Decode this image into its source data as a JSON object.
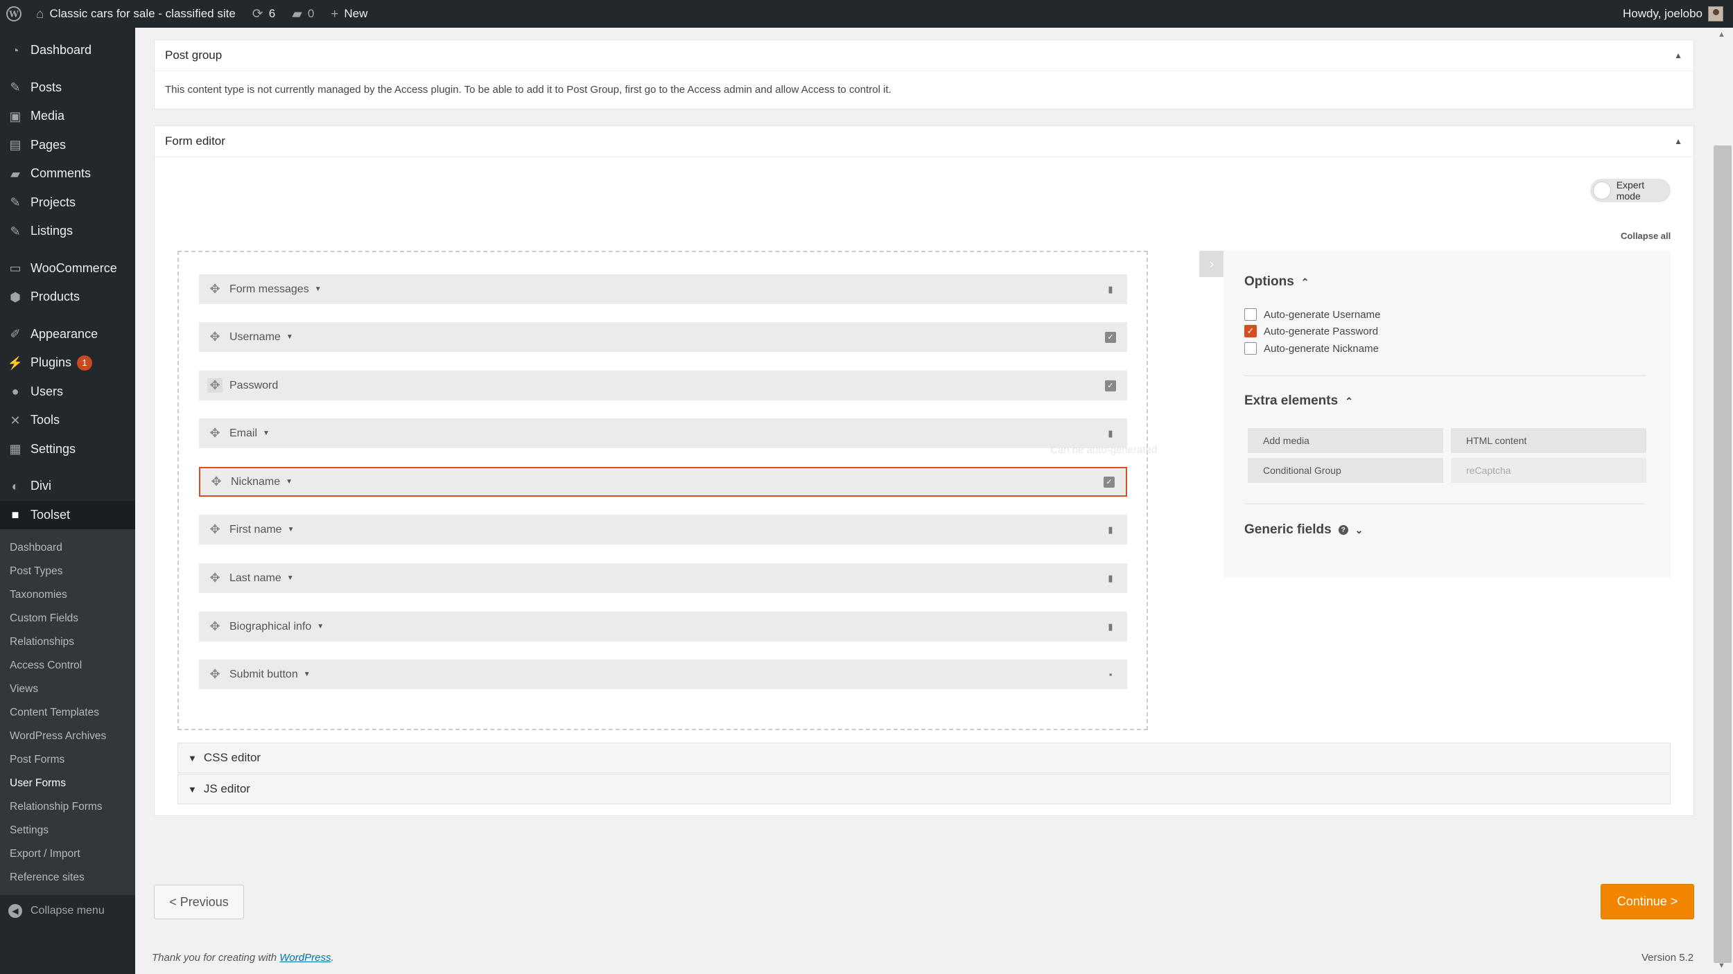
{
  "adminbar": {
    "site_title": "Classic cars for sale - classified site",
    "updates_count": "6",
    "comments_count": "0",
    "new_label": "New",
    "howdy": "Howdy, joelobo"
  },
  "menu": {
    "dashboard": "Dashboard",
    "posts": "Posts",
    "media": "Media",
    "pages": "Pages",
    "comments": "Comments",
    "projects": "Projects",
    "listings": "Listings",
    "woocommerce": "WooCommerce",
    "products": "Products",
    "appearance": "Appearance",
    "plugins": "Plugins",
    "plugins_count": "1",
    "users": "Users",
    "tools": "Tools",
    "settings": "Settings",
    "divi": "Divi",
    "toolset": "Toolset",
    "submenu": [
      "Dashboard",
      "Post Types",
      "Taxonomies",
      "Custom Fields",
      "Relationships",
      "Access Control",
      "Views",
      "Content Templates",
      "WordPress Archives",
      "Post Forms",
      "User Forms",
      "Relationship Forms",
      "Settings",
      "Export / Import",
      "Reference sites"
    ],
    "collapse": "Collapse menu"
  },
  "post_group": {
    "title": "Post group",
    "message": "This content type is not currently managed by the Access plugin. To be able to add it to Post Group, first go to the Access admin and allow Access to control it."
  },
  "form_editor": {
    "title": "Form editor",
    "expert_mode": "Expert mode",
    "collapse_all": "Collapse all",
    "ghost_text": "Can be auto-generated",
    "fields": [
      "Form messages",
      "Username",
      "Password",
      "Email",
      "Nickname",
      "First name",
      "Last name",
      "Biographical info",
      "Submit button"
    ],
    "options_title": "Options",
    "options": [
      {
        "label": "Auto-generate Username",
        "checked": false
      },
      {
        "label": "Auto-generate Password",
        "checked": true
      },
      {
        "label": "Auto-generate Nickname",
        "checked": false
      }
    ],
    "extra_title": "Extra elements",
    "extra": [
      "Add media",
      "HTML content",
      "Conditional Group",
      "reCaptcha"
    ],
    "generic_title": "Generic fields",
    "css_editor": "CSS editor",
    "js_editor": "JS editor"
  },
  "nav": {
    "previous": "< Previous",
    "continue": "Continue >"
  },
  "footer": {
    "thanks": "Thank you for creating with ",
    "wordpress": "WordPress",
    "period": ".",
    "version": "Version 5.2"
  },
  "colors": {
    "accent": "#d54e21",
    "continue": "#f18500",
    "adminbar": "#23282d"
  }
}
